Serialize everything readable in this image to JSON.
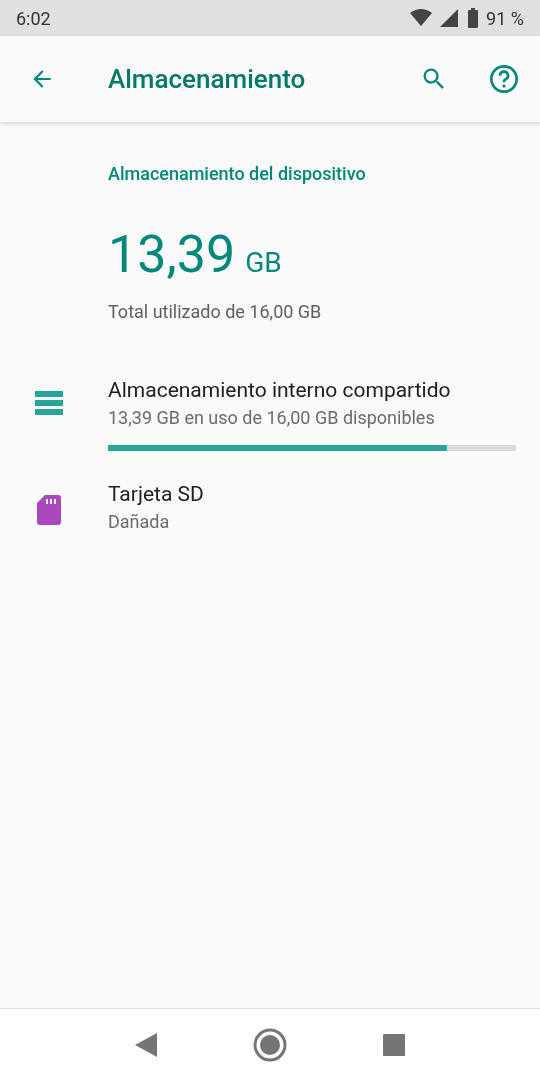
{
  "status_bar": {
    "time": "6:02",
    "battery": "91 %"
  },
  "toolbar": {
    "title": "Almacenamiento"
  },
  "section_title": "Almacenamiento del dispositivo",
  "summary": {
    "used": "13,39",
    "unit": "GB",
    "caption": "Total utilizado de 16,00 GB"
  },
  "volumes": [
    {
      "kind": "internal",
      "title": "Almacenamiento interno compartido",
      "subtitle": "13,39 GB en uso de 16,00 GB disponibles",
      "level": 0.83,
      "color": "#26a69a"
    },
    {
      "kind": "sd",
      "title": "Tarjeta SD",
      "subtitle": "Dañada",
      "color": "#ab47bc"
    }
  ]
}
